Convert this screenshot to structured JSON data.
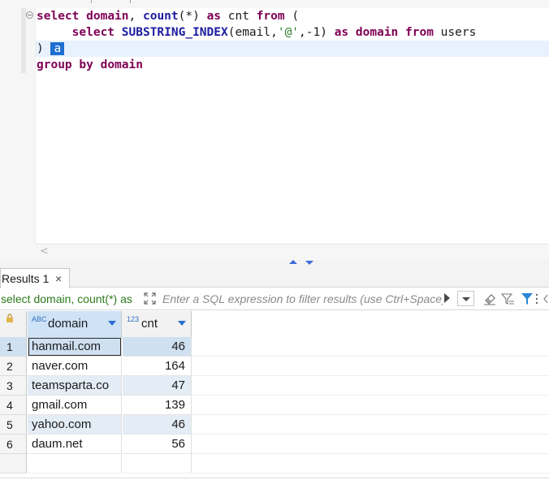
{
  "editor": {
    "lines": [
      {
        "parts": [
          {
            "t": "select",
            "k": "kw"
          },
          {
            "t": " ",
            "k": ""
          },
          {
            "t": "domain",
            "k": "kw"
          },
          {
            "t": ", ",
            "k": ""
          },
          {
            "t": "count",
            "k": "fn"
          },
          {
            "t": "(*) ",
            "k": ""
          },
          {
            "t": "as",
            "k": "kw"
          },
          {
            "t": " cnt ",
            "k": ""
          },
          {
            "t": "from",
            "k": "kw"
          },
          {
            "t": " (",
            "k": ""
          }
        ]
      },
      {
        "parts": [
          {
            "t": "     ",
            "k": ""
          },
          {
            "t": "select",
            "k": "kw"
          },
          {
            "t": " ",
            "k": ""
          },
          {
            "t": "SUBSTRING_INDEX",
            "k": "fn"
          },
          {
            "t": "(email,",
            "k": ""
          },
          {
            "t": "'@'",
            "k": "str"
          },
          {
            "t": ",-1) ",
            "k": ""
          },
          {
            "t": "as",
            "k": "kw"
          },
          {
            "t": " ",
            "k": ""
          },
          {
            "t": "domain",
            "k": "kw"
          },
          {
            "t": " ",
            "k": ""
          },
          {
            "t": "from",
            "k": "kw"
          },
          {
            "t": " users",
            "k": ""
          }
        ]
      },
      {
        "parts": [
          {
            "t": ") ",
            "k": ""
          },
          {
            "t": "a",
            "k": "sel-alias"
          }
        ]
      },
      {
        "parts": [
          {
            "t": "group",
            "k": "kw"
          },
          {
            "t": " ",
            "k": ""
          },
          {
            "t": "by",
            "k": "kw"
          },
          {
            "t": " ",
            "k": ""
          },
          {
            "t": "domain",
            "k": "kw"
          }
        ]
      }
    ],
    "scroll_left_glyph": "<"
  },
  "results": {
    "tab_label": "Results 1",
    "tab_close_glyph": "×",
    "filter_query_text": "select domain, count(*) as",
    "filter_placeholder": "Enter a SQL expression to filter results (use Ctrl+Space)",
    "columns": [
      {
        "type_badge": "ABC",
        "label": "domain"
      },
      {
        "type_badge": "123",
        "label": "cnt"
      }
    ],
    "rows": [
      {
        "n": "1",
        "domain": "hanmail.com",
        "cnt": "46"
      },
      {
        "n": "2",
        "domain": "naver.com",
        "cnt": "164"
      },
      {
        "n": "3",
        "domain": "teamsparta.co",
        "cnt": "47"
      },
      {
        "n": "4",
        "domain": "gmail.com",
        "cnt": "139"
      },
      {
        "n": "5",
        "domain": "yahoo.com",
        "cnt": "46"
      },
      {
        "n": "6",
        "domain": "daum.net",
        "cnt": "56"
      }
    ]
  },
  "colors": {
    "keyword": "#7f0055",
    "function": "#1c1ca0",
    "string": "#2a7a2a",
    "selection": "#1f6fd1",
    "filter_query": "#2c7a1c"
  }
}
